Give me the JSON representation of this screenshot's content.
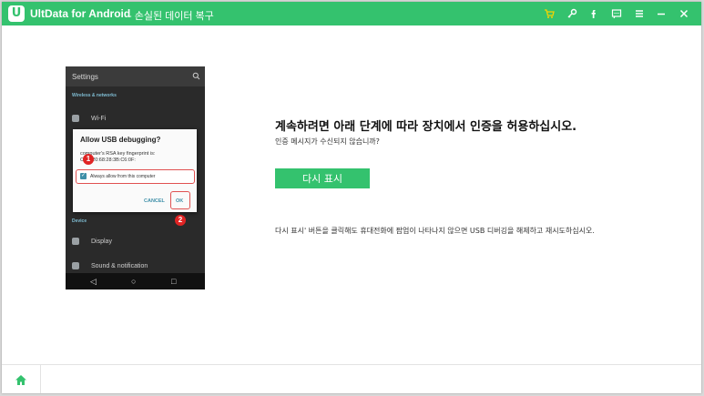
{
  "titlebar": {
    "logo_letter": "U",
    "app_name": "UltData for Android",
    "subtitle": "- 손실된 데이터 복구",
    "icons": [
      "cart-icon",
      "key-icon",
      "facebook-icon",
      "feedback-icon",
      "menu-icon",
      "minimize-icon",
      "close-icon"
    ]
  },
  "phone": {
    "header": "Settings",
    "section_wireless": "Wireless & networks",
    "item_wifi": "Wi-Fi",
    "section_device": "Device",
    "item_display": "Display",
    "item_sound": "Sound & notification",
    "dialog": {
      "title": "Allow USB debugging?",
      "fingerprint_line1": "computer's RSA key fingerprint is:",
      "fingerprint_line2": "C:52:20:68:28:3B:C6:0F:",
      "checkbox_label": "Always allow from this computer",
      "cancel": "CANCEL",
      "ok": "OK"
    },
    "markers": [
      "1",
      "2"
    ]
  },
  "main": {
    "heading": "계속하려면 아래 단계에 따라 장치에서 인증을 허용하십시오.",
    "subtext": "인증 메시지가 수신되지 않습니까?",
    "show_again_button": "다시 표시",
    "note": "다시 표시' 버튼을 클릭해도 휴대전화에 팝업이 나타나지 않으면 USB 디버깅을 해제하고 재시도하십시오."
  },
  "colors": {
    "brand_green": "#34c26e",
    "marker_red": "#e02424",
    "dialog_accent": "#3e8fa8"
  }
}
